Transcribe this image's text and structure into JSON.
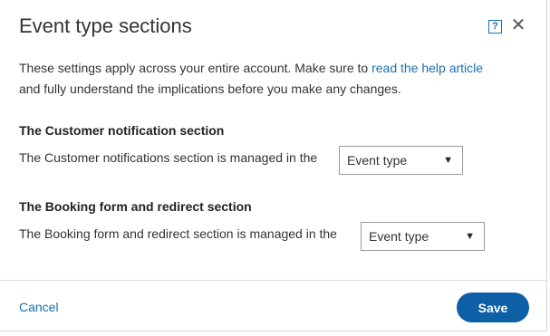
{
  "dialog": {
    "title": "Event type sections",
    "help_icon": "help-icon",
    "help_glyph": "?",
    "close_icon": "close-icon",
    "close_glyph": "✕"
  },
  "intro": {
    "text_before": "These settings apply across your entire account. Make sure to ",
    "link": "read the help article",
    "text_after": "and fully understand the implications before you make any changes."
  },
  "sections": [
    {
      "title": "The Customer notification section",
      "text": "The Customer notifications section is managed in the",
      "select_value": "Event type",
      "arrow": "▼"
    },
    {
      "title": "The Booking form and redirect section",
      "text": "The Booking form and redirect section is managed in the",
      "select_value": "Event type",
      "arrow": "▼"
    }
  ],
  "footer": {
    "cancel_label": "Cancel",
    "save_label": "Save"
  },
  "colors": {
    "accent": "#1a6fb0",
    "save_button": "#0d5fa6"
  }
}
